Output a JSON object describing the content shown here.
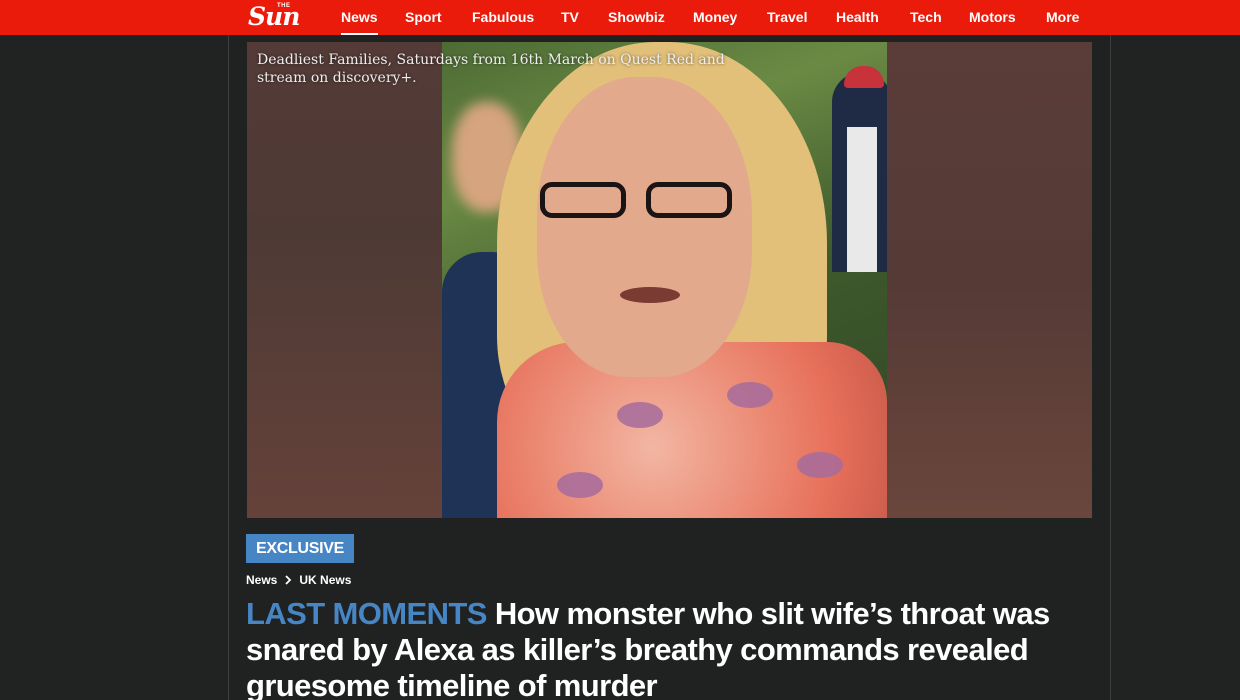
{
  "site": {
    "logo_the": "THE",
    "logo_word": "Sun"
  },
  "nav": {
    "items": [
      {
        "label": "News",
        "active": true
      },
      {
        "label": "Sport",
        "active": false
      },
      {
        "label": "Fabulous",
        "active": false
      },
      {
        "label": "TV",
        "active": false
      },
      {
        "label": "Showbiz",
        "active": false
      },
      {
        "label": "Money",
        "active": false
      },
      {
        "label": "Travel",
        "active": false
      },
      {
        "label": "Health",
        "active": false
      },
      {
        "label": "Tech",
        "active": false
      },
      {
        "label": "Motors",
        "active": false
      },
      {
        "label": "More",
        "active": false
      }
    ]
  },
  "video": {
    "caption": "Deadliest Families, Saturdays from 16th March on Quest Red and stream on discovery+."
  },
  "article": {
    "badge": "EXCLUSIVE",
    "breadcrumb": [
      "News",
      "UK News"
    ],
    "kicker": "LAST MOMENTS",
    "headline": "How monster who slit wife’s throat was snared by Alexa as killer’s breathy commands revealed gruesome timeline of murder"
  },
  "colors": {
    "brand_red": "#eb1b0b",
    "accent_blue": "#4786c5",
    "background": "#212323"
  }
}
